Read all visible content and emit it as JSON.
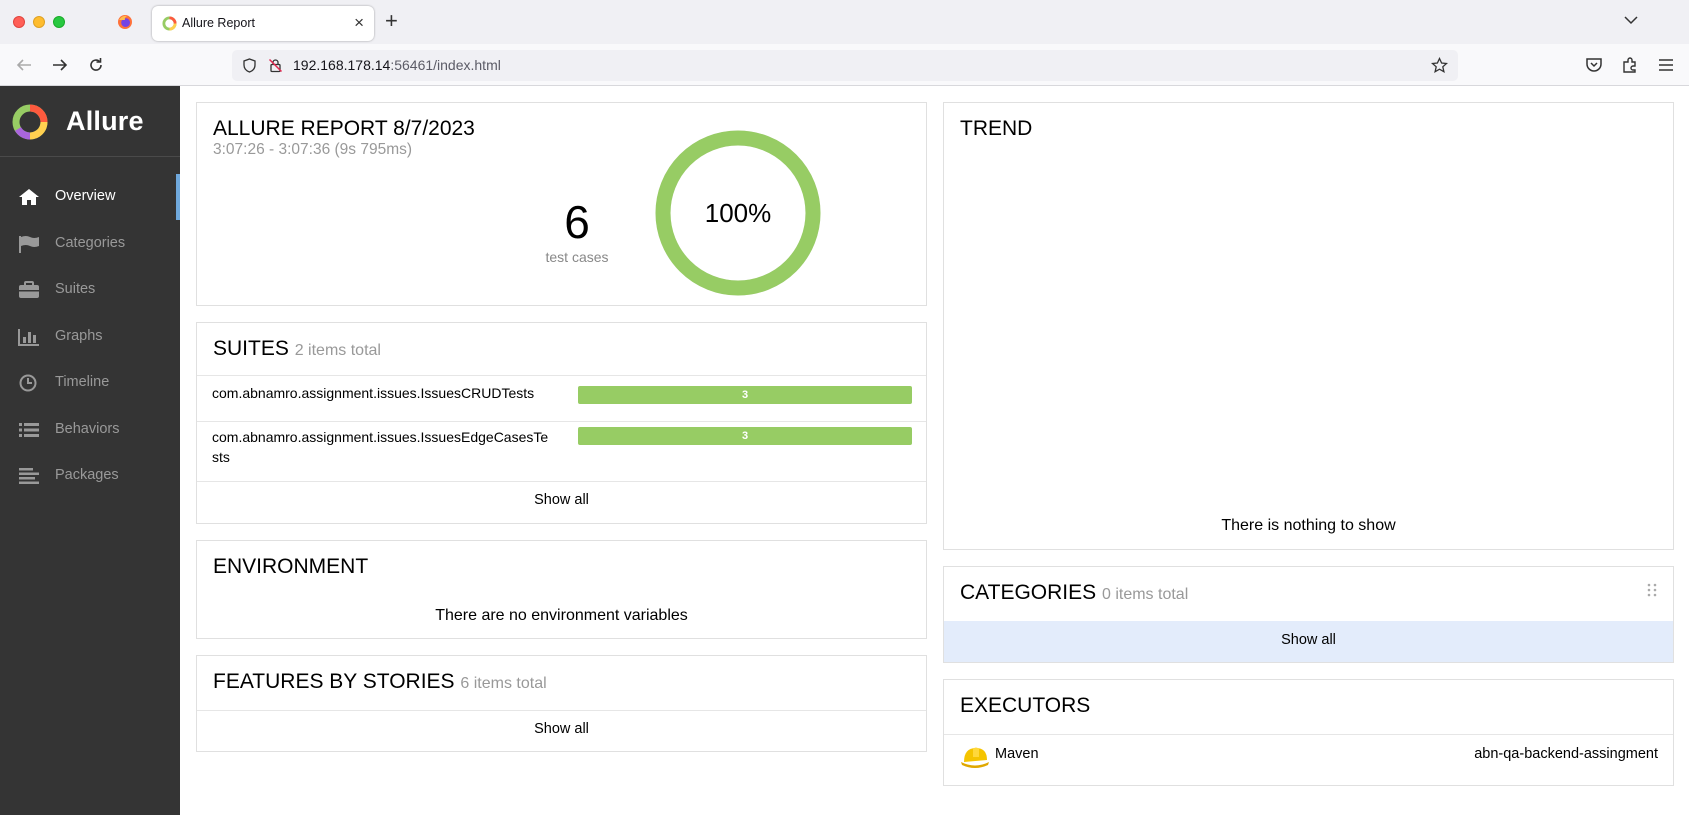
{
  "browser": {
    "tab_title": "Allure Report",
    "url_host": "192.168.178.14",
    "url_rest": ":56461/index.html"
  },
  "sidebar": {
    "brand": "Allure",
    "items": [
      {
        "label": "Overview",
        "icon": "home-icon",
        "active": true
      },
      {
        "label": "Categories",
        "icon": "flag-icon",
        "active": false
      },
      {
        "label": "Suites",
        "icon": "briefcase-icon",
        "active": false
      },
      {
        "label": "Graphs",
        "icon": "bar-chart-icon",
        "active": false
      },
      {
        "label": "Timeline",
        "icon": "clock-icon",
        "active": false
      },
      {
        "label": "Behaviors",
        "icon": "list-icon",
        "active": false
      },
      {
        "label": "Packages",
        "icon": "align-left-icon",
        "active": false
      }
    ]
  },
  "summary": {
    "title": "ALLURE REPORT 8/7/2023",
    "time_range": "3:07:26 - 3:07:36 (9s 795ms)",
    "test_count": "6",
    "test_count_label": "test cases",
    "success_rate": "100%",
    "success_fraction": 1.0,
    "color_passed": "#97cc64"
  },
  "suites": {
    "title": "SUITES",
    "subtitle": "2 items total",
    "rows": [
      {
        "name": "com.abnamro.assignment.issues.IssuesCRUDTests",
        "passed": "3"
      },
      {
        "name": "com.abnamro.assignment.issues.IssuesEdgeCasesTests",
        "passed": "3"
      }
    ],
    "show_all": "Show all"
  },
  "environment": {
    "title": "ENVIRONMENT",
    "empty_text": "There are no environment variables"
  },
  "features": {
    "title": "FEATURES BY STORIES",
    "subtitle": "6 items total",
    "show_all": "Show all"
  },
  "trend": {
    "title": "TREND",
    "empty_text": "There is nothing to show"
  },
  "categories": {
    "title": "CATEGORIES",
    "subtitle": "0 items total",
    "show_all": "Show all"
  },
  "executors": {
    "title": "EXECUTORS",
    "name": "Maven",
    "build": "abn-qa-backend-assingment"
  }
}
